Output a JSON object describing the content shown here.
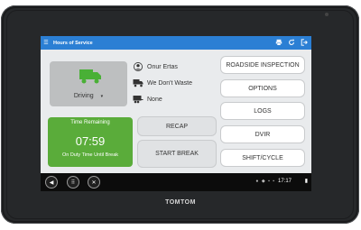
{
  "app": {
    "title": "Hours of Service"
  },
  "topbar_icons": [
    "print-icon",
    "refresh-icon",
    "logout-icon"
  ],
  "driver": {
    "status": "Driving",
    "name": "Onur Ertas",
    "carrier": "We Don't Waste",
    "trailer": "None"
  },
  "time_remaining": {
    "label": "Time Remaining",
    "value": "07:59",
    "sublabel": "On Duty Time Until Break"
  },
  "actions": {
    "recap": "RECAP",
    "start_break": "START BREAK"
  },
  "menu": [
    "ROADSIDE INSPECTION",
    "OPTIONS",
    "LOGS",
    "DVIR",
    "SHIFT/CYCLE"
  ],
  "system": {
    "clock": "17:17"
  },
  "device": {
    "brand": "TOMTOM"
  },
  "colors": {
    "header": "#2b7fd4",
    "status_green": "#5aac3a",
    "truck_green": "#49b036"
  }
}
